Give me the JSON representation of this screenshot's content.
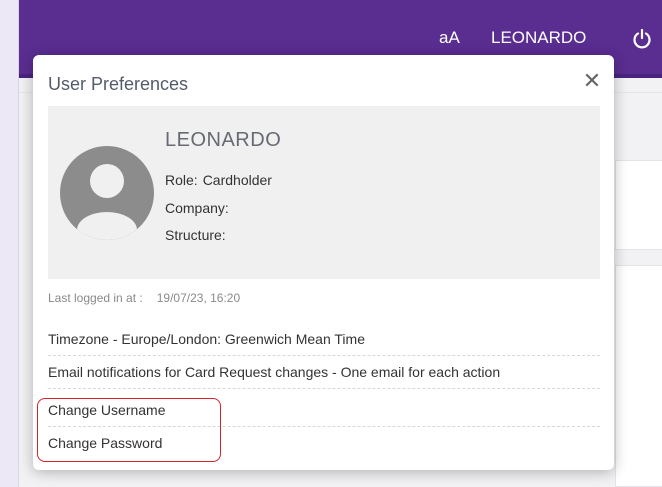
{
  "header": {
    "font_size_label": "aA",
    "user_name": "LEONARDO",
    "power_icon": "power-icon",
    "bg_color": "#5a2d91"
  },
  "modal": {
    "title": "User Preferences",
    "close_label": "✕",
    "profile": {
      "name": "LEONARDO",
      "role_label": "Role:",
      "role_value": "Cardholder",
      "company_label": "Company:",
      "company_value": "",
      "structure_label": "Structure:",
      "structure_value": ""
    },
    "last_login_label": "Last logged in at :",
    "last_login_value": "19/07/23, 16:20",
    "preferences": {
      "timezone": "Timezone - Europe/London: Greenwich Mean Time",
      "email_notifications": "Email notifications for Card Request changes - One email for each action",
      "change_username": "Change Username",
      "change_password": "Change Password"
    }
  },
  "colors": {
    "accent": "#5a2d91",
    "highlight": "#d3232d"
  }
}
